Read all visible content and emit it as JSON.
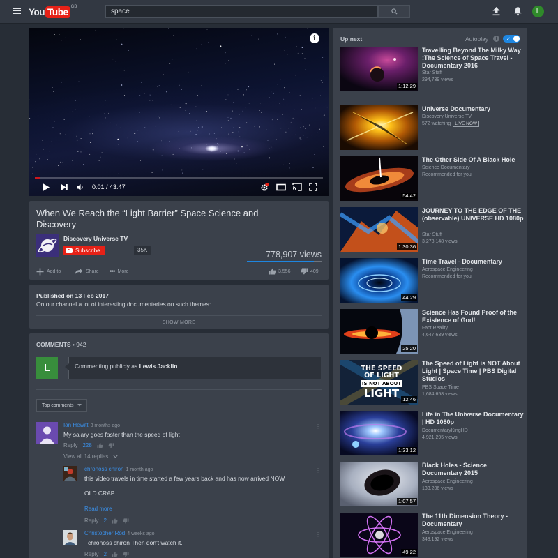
{
  "header": {
    "logo_you": "You",
    "logo_tube": "Tube",
    "logo_country": "GB",
    "search_value": "space",
    "avatar_letter": "L"
  },
  "player": {
    "time_current": "0:01",
    "time_total": "43:47",
    "progress_fraction": 0.004,
    "info_glyph": "i"
  },
  "video": {
    "title": "When We Reach the “Light Barrier” Space Science and Discovery",
    "channel": "Discovery Universe TV",
    "subscribe_label": "Subscribe",
    "subscriber_count": "35K",
    "views": "778,907 views",
    "like_fraction": 0.9,
    "actions": {
      "add_to": "Add to",
      "share": "Share",
      "more": "More"
    },
    "likes": "3,556",
    "dislikes": "409"
  },
  "description": {
    "published": "Published on 13 Feb 2017",
    "text": "On our channel a lot of interesting documentaries on such themes:",
    "show_more": "SHOW MORE"
  },
  "comments": {
    "heading": "COMMENTS",
    "count": "• 942",
    "my_avatar_letter": "L",
    "commenting_as_prefix": "Commenting publicly as",
    "commenting_as_name": "Lewis Jacklin",
    "sort_label": "Top comments",
    "items": [
      {
        "author": "Ian Hewitt",
        "time": "3 months ago",
        "text": "My salary goes faster than the speed of light",
        "reply": "Reply",
        "likes": "228",
        "view_replies": "View all 14 replies"
      },
      {
        "author": "chronoss chiron",
        "time": "1 month ago",
        "text": "this video travels in time started a few years back and has now arrived NOW",
        "text2": "OLD CRAP",
        "read_more": "Read more",
        "reply": "Reply",
        "likes": "2"
      },
      {
        "author": "Christopher Rod",
        "time": "4 weeks ago",
        "text": "+chronoss chiron Then don't watch it.",
        "reply": "Reply",
        "likes": "2"
      }
    ]
  },
  "sidebar": {
    "up_next": "Up next",
    "autoplay": "Autoplay",
    "autoplay_on": true,
    "items": [
      {
        "title": "Travelling Beyond The Milky Way :The Science of Space Travel - Documentary 2016",
        "channel": "Star Staff",
        "meta": "294,739 views",
        "duration": "1:12:29"
      },
      {
        "title": "Universe Documentary",
        "channel": "Discovery Universe TV",
        "meta": "572 watching",
        "live": "LIVE NOW",
        "duration": ""
      },
      {
        "title": "The Other Side Of A Black Hole",
        "channel": "Science Documentary",
        "meta": "Recommended for you",
        "duration": "54:42"
      },
      {
        "title": "JOURNEY TO THE EDGE OF THE (observable) UNIVERSE HD 1080p",
        "channel": "Star Stuff",
        "meta": "3,278,148 views",
        "duration": "1:30:36"
      },
      {
        "title": "Time Travel - Documentary",
        "channel": "Aerospace Engineering",
        "meta": "Recommended for you",
        "duration": "44:29"
      },
      {
        "title": "Science Has Found Proof of the Existence of God!",
        "channel": "Fact Reality",
        "meta": "4,647,639 views",
        "duration": "25:20"
      },
      {
        "title": "The Speed of Light is NOT About Light | Space Time | PBS Digital Studios",
        "channel": "PBS Space Time",
        "meta": "1,684,658 views",
        "duration": "12:46",
        "thumb_lines": [
          "THE SPEED",
          "OF LIGHT",
          "IS NOT ABOUT",
          "LIGHT"
        ]
      },
      {
        "title": "Life in The Universe Documentary | HD 1080p",
        "channel": "DocumentaryKingHD",
        "meta": "4,921,295 views",
        "duration": "1:33:12"
      },
      {
        "title": "Black Holes - Science Documentary 2015",
        "channel": "Aerospace Engineering",
        "meta": "133,206 views",
        "duration": "1:07:57"
      },
      {
        "title": "The 11th Dimension Theory - Documentary",
        "channel": "Aerospace Engineering",
        "meta": "348,192 views",
        "duration": "49:22"
      }
    ]
  },
  "icons": {
    "menu": "menu-icon",
    "search": "search-icon",
    "upload": "upload-icon",
    "bell": "bell-icon",
    "play": "play-icon",
    "next": "next-icon",
    "volume": "volume-icon",
    "settings": "settings-icon",
    "theater": "theater-icon",
    "cast": "cast-icon",
    "fullscreen": "fullscreen-icon"
  },
  "colors": {
    "brand_red": "#e62117",
    "link_blue": "#3a8ee6",
    "page_bg": "#272d36",
    "card_bg": "#3b414b"
  }
}
